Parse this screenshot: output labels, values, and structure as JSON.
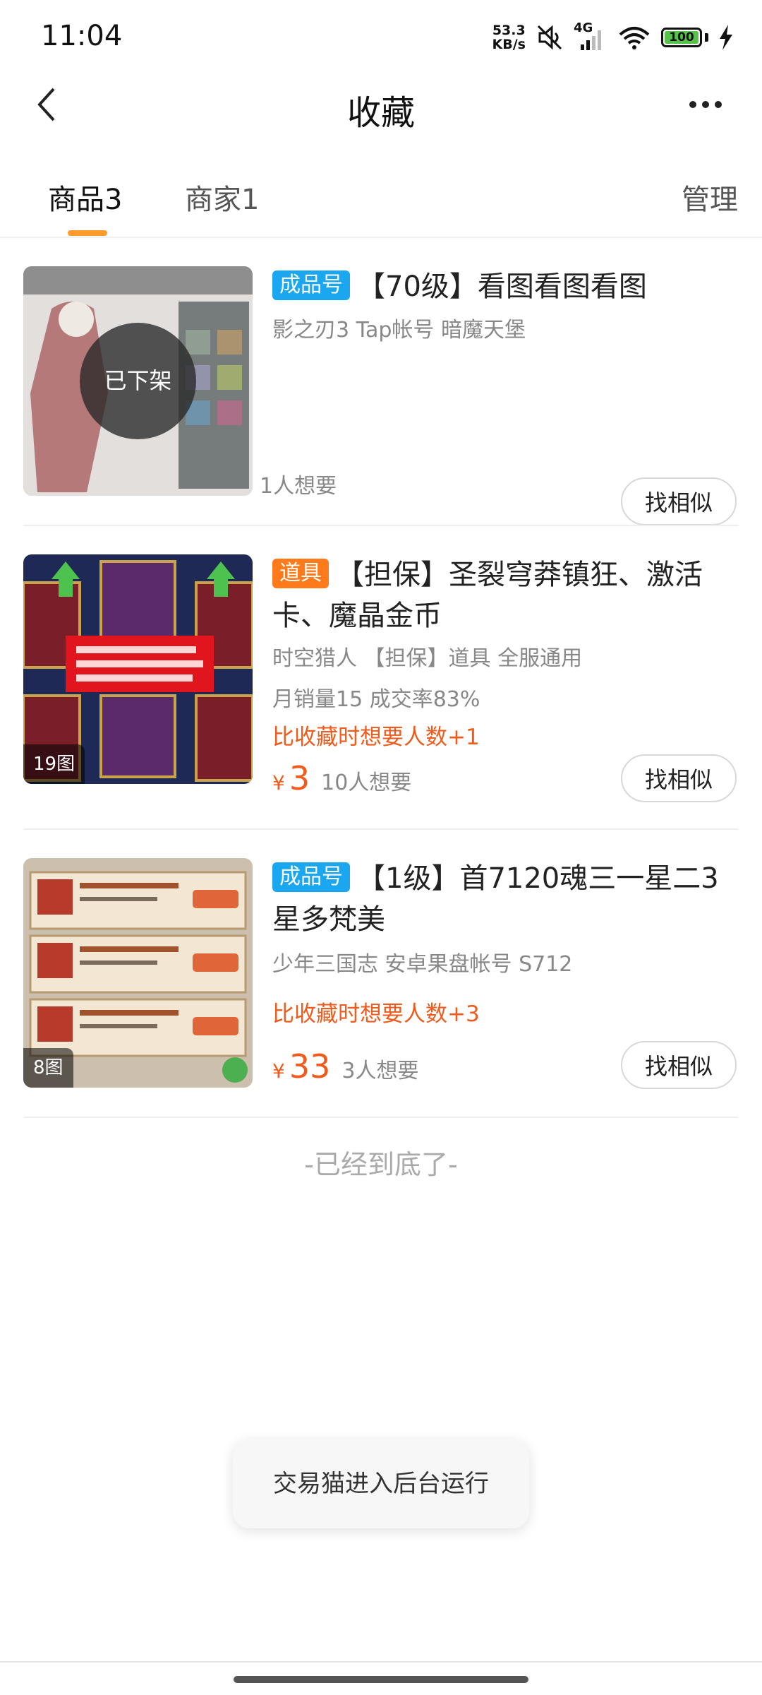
{
  "status_bar": {
    "time": "11:04",
    "net_speed_value": "53.3",
    "net_speed_unit": "KB/s",
    "signal_label": "4G",
    "battery": "100",
    "icons": [
      "mute-icon",
      "signal-icon",
      "wifi-icon",
      "battery-icon",
      "charging-icon"
    ]
  },
  "header": {
    "title": "收藏",
    "back_icon": "back-arrow-icon",
    "more_icon": "more-dots-icon"
  },
  "tabs": {
    "items": [
      {
        "label": "商品3",
        "active": true
      },
      {
        "label": "商家1",
        "active": false
      }
    ],
    "manage_label": "管理",
    "accent": "#ff9a2b"
  },
  "items": [
    {
      "tag": "成品号",
      "tag_color": "#1aa7f0",
      "title": "【70级】看图看图看图",
      "subtitle": "影之刃3 Tap帐号  暗魔天堡",
      "overlay": "已下架",
      "want": "1人想要",
      "similar_label": "找相似"
    },
    {
      "tag": "道具",
      "tag_color": "#ff7a1a",
      "title": "【担保】圣裂穹莽镇狂、激活卡、魔晶金币",
      "subtitle": "时空猎人 【担保】道具  全服通用",
      "stats": "月销量15 成交率83%",
      "hint": "比收藏时想要人数+1",
      "price_symbol": "¥",
      "price": "3",
      "want": "10人想要",
      "image_count": "19图",
      "similar_label": "找相似"
    },
    {
      "tag": "成品号",
      "tag_color": "#1aa7f0",
      "title": "【1级】首7120魂三一星二3星多梵美",
      "subtitle": "少年三国志 安卓果盘帐号  S712",
      "hint": "比收藏时想要人数+3",
      "price_symbol": "¥",
      "price": "33",
      "want": "3人想要",
      "image_count": "8图",
      "similar_label": "找相似"
    }
  ],
  "end_text": "-已经到底了-",
  "toast": "交易猫进入后台运行",
  "colors": {
    "price": "#f05a1a",
    "tag_blue": "#1aa7f0",
    "tag_orange": "#ff7a1a"
  }
}
